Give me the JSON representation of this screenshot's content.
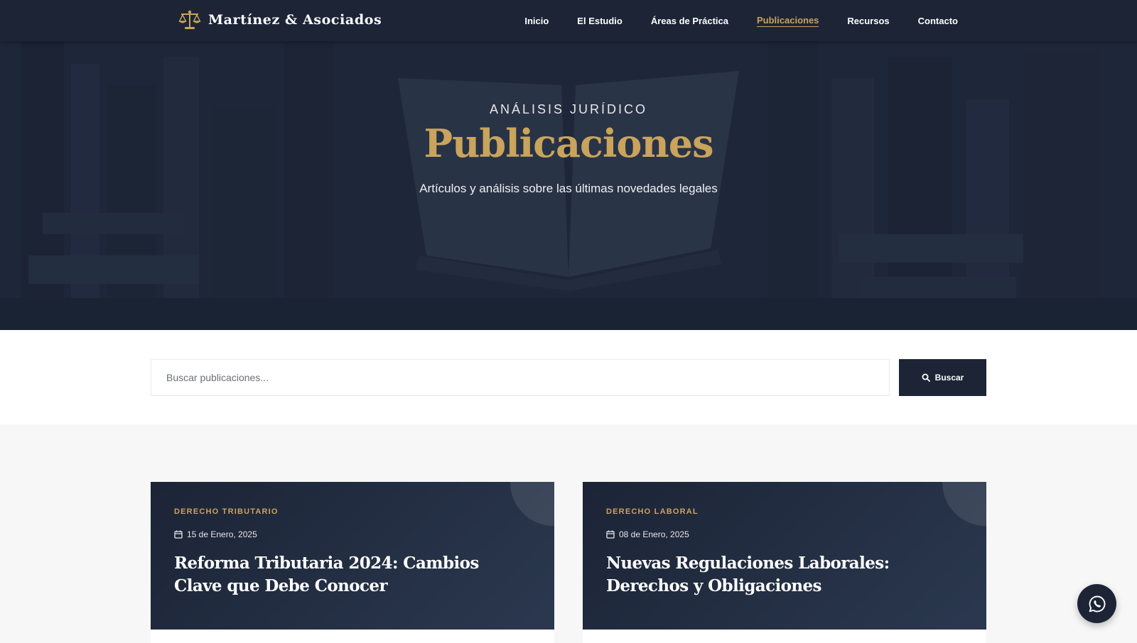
{
  "nav": {
    "brand": "Martínez & Asociados",
    "items": [
      {
        "label": "Inicio",
        "active": false
      },
      {
        "label": "El Estudio",
        "active": false
      },
      {
        "label": "Áreas de Práctica",
        "active": false
      },
      {
        "label": "Publicaciones",
        "active": true
      },
      {
        "label": "Recursos",
        "active": false
      },
      {
        "label": "Contacto",
        "active": false
      }
    ]
  },
  "hero": {
    "eyebrow": "ANÁLISIS JURÍDICO",
    "title": "Publicaciones",
    "subtitle": "Artículos y análisis sobre las últimas novedades legales"
  },
  "search": {
    "placeholder": "Buscar publicaciones...",
    "button_label": "Buscar"
  },
  "cards": [
    {
      "category": "DERECHO TRIBUTARIO",
      "date": "15 de Enero, 2025",
      "title": "Reforma Tributaria 2024: Cambios Clave que Debe Conocer"
    },
    {
      "category": "DERECHO LABORAL",
      "date": "08 de Enero, 2025",
      "title": "Nuevas Regulaciones Laborales: Derechos y Obligaciones"
    }
  ],
  "colors": {
    "navy": "#1c2436",
    "gold": "#c9a45c",
    "background": "#f7f7f7"
  },
  "icons": [
    "scales-of-justice-icon",
    "search-icon",
    "calendar-icon",
    "whatsapp-icon"
  ]
}
